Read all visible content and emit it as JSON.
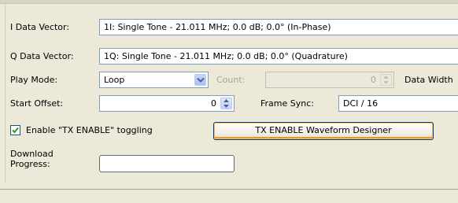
{
  "fields": {
    "i_vector": {
      "label": "I Data Vector:",
      "value": "1I: Single Tone - 21.011 MHz; 0.0 dB; 0.0° (In-Phase)"
    },
    "q_vector": {
      "label": "Q Data Vector:",
      "value": "1Q: Single Tone - 21.011 MHz; 0.0 dB; 0.0° (Quadrature)"
    },
    "play_mode": {
      "label": "Play Mode:",
      "value": "Loop"
    },
    "count": {
      "label": "Count:",
      "value": "0"
    },
    "data_width": {
      "label": "Data Width"
    },
    "start_offset": {
      "label": "Start Offset:",
      "value": "0"
    },
    "frame_sync": {
      "label": "Frame Sync:",
      "value": "DCI / 16"
    },
    "tx_enable_toggle": {
      "label": "Enable \"TX ENABLE\" toggling",
      "checked": true
    },
    "tx_designer_button": {
      "label": "TX ENABLE Waveform Designer"
    },
    "download": {
      "label_line1": "Download",
      "label_line2": "Progress:",
      "progress": 0
    }
  },
  "icons": {
    "combo_arrow": "chevron-down-icon",
    "spin_up": "arrow-up-icon",
    "spin_down": "arrow-down-icon",
    "check": "checkmark-icon"
  },
  "colors": {
    "window_bg": "#ece9d8",
    "field_border": "#7f9db9",
    "button_focus": "#e59a31",
    "check": "#21a121"
  }
}
